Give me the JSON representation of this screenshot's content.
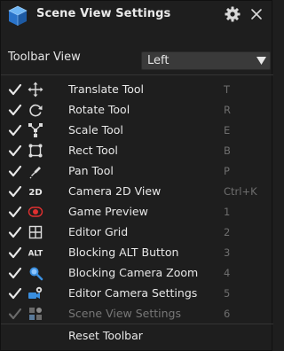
{
  "header": {
    "title": "Scene View Settings",
    "logo_icon": "cube-logo-icon",
    "settings_icon": "gear-icon",
    "close_icon": "close-icon"
  },
  "toolbar_view": {
    "label": "Toolbar View",
    "selected": "Left"
  },
  "tools": [
    {
      "label": "Translate Tool",
      "key": "T",
      "checked": true,
      "icon": "translate-icon"
    },
    {
      "label": "Rotate Tool",
      "key": "R",
      "checked": true,
      "icon": "rotate-icon"
    },
    {
      "label": "Scale Tool",
      "key": "E",
      "checked": true,
      "icon": "scale-icon"
    },
    {
      "label": "Rect Tool",
      "key": "B",
      "checked": true,
      "icon": "rect-icon"
    },
    {
      "label": "Pan Tool",
      "key": "P",
      "checked": true,
      "icon": "pan-icon"
    },
    {
      "label": "Camera 2D View",
      "key": "Ctrl+K",
      "checked": true,
      "icon": "camera-2d-icon",
      "icon_text": "2D"
    },
    {
      "label": "Game Preview",
      "key": "1",
      "checked": true,
      "icon": "game-preview-icon"
    },
    {
      "label": "Editor Grid",
      "key": "2",
      "checked": true,
      "icon": "grid-icon"
    },
    {
      "label": "Blocking ALT Button",
      "key": "3",
      "checked": true,
      "icon": "alt-key-icon",
      "icon_text": "ALT"
    },
    {
      "label": "Blocking Camera Zoom",
      "key": "4",
      "checked": true,
      "icon": "magnifier-icon"
    },
    {
      "label": "Editor Camera Settings",
      "key": "5",
      "checked": true,
      "icon": "camera-settings-icon"
    },
    {
      "label": "Scene View Settings",
      "key": "6",
      "checked": true,
      "disabled": true,
      "icon": "scene-settings-icon"
    }
  ],
  "reset": {
    "label": "Reset Toolbar"
  },
  "colors": {
    "background": "#1e1e1e",
    "accent_blue": "#3a8fe0",
    "record_red": "#e03030",
    "dim_text": "#777777"
  }
}
